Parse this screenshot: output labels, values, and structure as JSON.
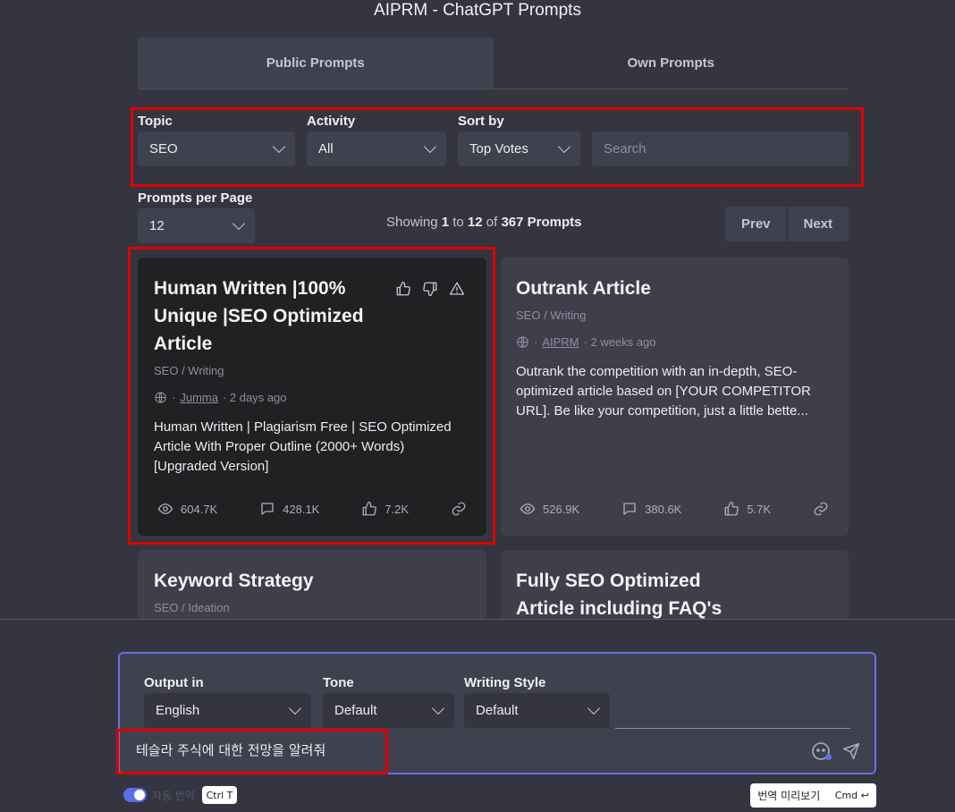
{
  "app": {
    "title": "AIPRM - ChatGPT Prompts"
  },
  "tabs": [
    {
      "label": "Public Prompts",
      "active": true
    },
    {
      "label": "Own Prompts",
      "active": false
    }
  ],
  "filters": {
    "topic_label": "Topic",
    "topic_value": "SEO",
    "activity_label": "Activity",
    "activity_value": "All",
    "sort_label": "Sort by",
    "sort_value": "Top Votes",
    "search_placeholder": "Search"
  },
  "paging": {
    "per_page_label": "Prompts per Page",
    "per_page_value": "12",
    "showing_prefix": "Showing",
    "from": "1",
    "to_word": "to",
    "to": "12",
    "of_word": "of",
    "total": "367 Prompts",
    "prev": "Prev",
    "next": "Next"
  },
  "cards": [
    {
      "title_lines": [
        "Human Written |100%",
        "Unique |SEO Optimized",
        "Article"
      ],
      "category": "SEO / Writing",
      "author": "Jumma",
      "age": "· 2 days ago",
      "desc_lines": [
        "Human Written | Plagiarism Free | SEO Optimized",
        "Article With Proper Outline (2000+ Words)",
        "[Upgraded Version]"
      ],
      "views": "604.7K",
      "comments": "428.1K",
      "likes": "7.2K"
    },
    {
      "title_lines": [
        "Outrank Article"
      ],
      "category": "SEO / Writing",
      "author": "AIPRM",
      "age": "· 2 weeks ago",
      "desc_lines": [
        "Outrank the competition with an in-depth, SEO-",
        "optimized article based on [YOUR COMPETITOR",
        "URL]. Be like your competition, just a little bette..."
      ],
      "views": "526.9K",
      "comments": "380.6K",
      "likes": "5.7K"
    },
    {
      "title_lines": [
        "Keyword Strategy"
      ],
      "category": "SEO / Ideation"
    },
    {
      "title_lines": [
        "Fully SEO Optimized",
        "Article including FAQ's"
      ]
    }
  ],
  "composer": {
    "output_label": "Output in",
    "output_value": "English",
    "tone_label": "Tone",
    "tone_value": "Default",
    "style_label": "Writing Style",
    "style_value": "Default",
    "prompt_text": "테슬라 주식에 대한 전망을 알려줘"
  },
  "footer": {
    "auto_translate_label": "자동 번역",
    "shortcut": "Ctrl T",
    "preview_label": "번역 미리보기",
    "preview_shortcut": "Cmd ↩"
  },
  "colors": {
    "highlight": "#e00000",
    "accent": "#6b6fe0",
    "toggle": "#5b6ee6"
  }
}
